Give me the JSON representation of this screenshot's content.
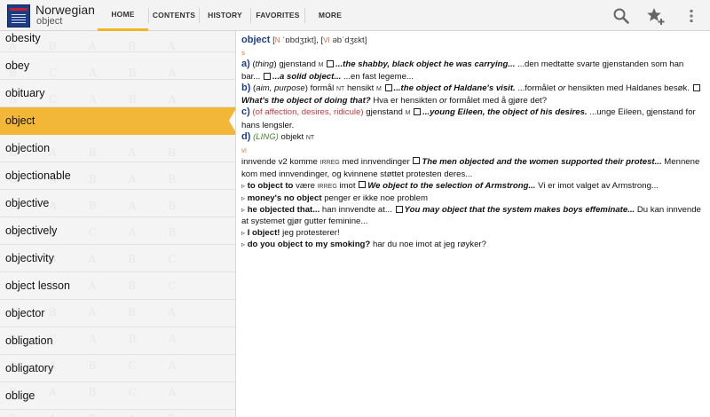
{
  "app": {
    "title": "Norwegian",
    "subtitle": "object"
  },
  "tabs": [
    {
      "label": "HOME",
      "active": true
    },
    {
      "label": "CONTENTS",
      "active": false
    },
    {
      "label": "HISTORY",
      "active": false
    },
    {
      "label": "FAVORITES",
      "active": false
    },
    {
      "label": "MORE",
      "active": false
    }
  ],
  "colors": {
    "accent": "#f3b737",
    "headword": "#1b3f8b"
  },
  "actions": {
    "search_icon": "search-icon",
    "favorite_icon": "star-plus-icon",
    "overflow_icon": "overflow-menu-icon"
  },
  "wordlist": {
    "items": [
      "obesity",
      "obey",
      "obituary",
      "object",
      "objection",
      "objectionable",
      "objective",
      "objectively",
      "objectivity",
      "object lesson",
      "objector",
      "obligation",
      "obligatory",
      "oblige"
    ],
    "selected_index": 3
  },
  "entry": {
    "headword": "object",
    "pos_n": "N",
    "pron_n": "ˈɒbdʒɪkt",
    "pos_vi": "VI",
    "pron_vi": "əbˈdʒɛkt",
    "section_s": "s",
    "section_vi": "vi",
    "sense_a": {
      "num": "a)",
      "label": "thing",
      "translation": "gjenstand",
      "gram": "M",
      "ex1": "...the shabby, black object he was carrying...",
      "tr1": "...den medtatte svarte gjenstanden som han bar...",
      "ex2": "...a solid object...",
      "tr2": "...en fast legeme..."
    },
    "sense_b": {
      "num": "b)",
      "label": "aim, purpose",
      "translation": "formål",
      "gram1": "NT",
      "translation2": "hensikt",
      "gram2": "M",
      "ex1": "...the object of Haldane's visit.",
      "tr1_part1": "...formålet",
      "tr1_or": "or",
      "tr1_part2": "hensikten med Haldanes besøk.",
      "ex2": "What's the object of doing that?",
      "tr2": "Hva er hensikten",
      "tr2_or": "or",
      "tr2_part2": "formålet med å gjøre det?"
    },
    "sense_c": {
      "num": "c)",
      "label": "of affection, desires, ridicule",
      "translation": "gjenstand",
      "gram": "M",
      "ex1": "...young Eileen, the object of his desires.",
      "tr1": "...unge Eileen, gjenstand for hans lengsler."
    },
    "sense_d": {
      "num": "d)",
      "label": "LING",
      "translation": "objekt",
      "gram": "NT"
    },
    "verb": {
      "tr1": "innvende",
      "v2": "v2",
      "tr1b": "komme",
      "irreg": "IRREG",
      "tr1c": "med innvendinger",
      "ex1": "The men objected and the women supported their protest...",
      "tr_ex1": "Mennene kom med innvendinger, og kvinnene støttet protesten deres..."
    },
    "phrases": [
      {
        "phrase": "to object to",
        "tr": "være",
        "gram": "IRREG",
        "tr2": "imot",
        "ex": "We object to the selection of Armstrong...",
        "tr_ex": "Vi er imot valget av Armstrong..."
      },
      {
        "phrase": "money's no object",
        "tr": "penger er ikke noe problem"
      },
      {
        "phrase": "he objected that...",
        "tr": "han innvendte at...",
        "ex": "You may object that the system makes boys effeminate...",
        "tr_ex": "Du kan innvende at systemet gjør gutter feminine..."
      },
      {
        "phrase": "I object!",
        "tr": "jeg protesterer!"
      },
      {
        "phrase": "do you object to my smoking?",
        "tr": "har du noe imot at jeg røyker?"
      }
    ]
  }
}
